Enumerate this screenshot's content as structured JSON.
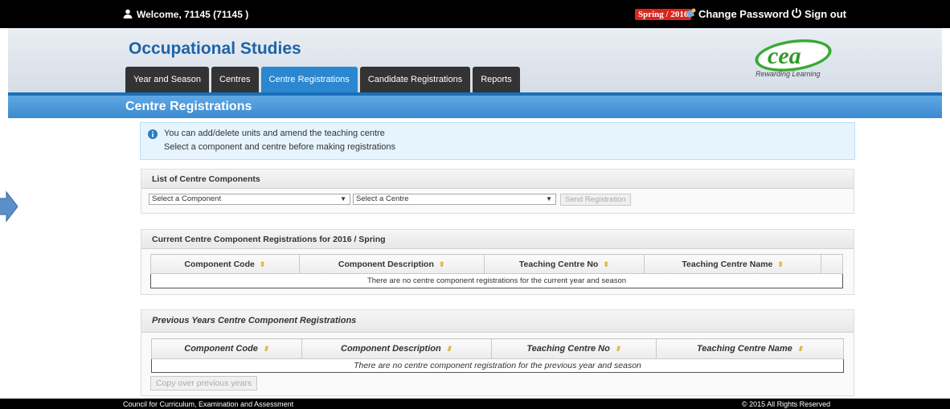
{
  "topbar": {
    "welcome": "Welcome, 71145 (71145 )",
    "season_badge": "Spring / 2016",
    "change_password": "Change Password",
    "sign_out": "Sign out"
  },
  "header": {
    "title": "Occupational Studies",
    "logo_text": "cea",
    "logo_tagline": "Rewarding Learning",
    "tabs": [
      {
        "label": "Year and Season"
      },
      {
        "label": "Centres"
      },
      {
        "label": "Centre Registrations",
        "active": true
      },
      {
        "label": "Candidate Registrations"
      },
      {
        "label": "Reports"
      }
    ]
  },
  "page": {
    "title": "Centre Registrations"
  },
  "info": {
    "line1": "You can add/delete units and amend the teaching centre",
    "line2": "Select a component and centre before making registrations"
  },
  "components_panel": {
    "title": "List of Centre Components",
    "component_select": "Select a Component",
    "centre_select": "Select a Centre",
    "send_button": "Send Registration"
  },
  "current_panel": {
    "title": "Current Centre Component Registrations for 2016 / Spring",
    "columns": [
      "Component Code",
      "Component Description",
      "Teaching Centre No",
      "Teaching Centre Name"
    ],
    "empty_message": "There are no centre component registrations for the current year and season"
  },
  "previous_panel": {
    "title": "Previous Years Centre Component Registrations",
    "columns": [
      "Component Code",
      "Component Description",
      "Teaching Centre No",
      "Teaching Centre Name"
    ],
    "empty_message": "There are no centre component registration for the previous year and season",
    "copy_button": "Copy over previous years"
  },
  "footer": {
    "left": "Council for Curriculum, Examination and Assessment",
    "right": "© 2015 All Rights Reserved"
  },
  "colors": {
    "accent": "#2a87d0",
    "title_blue": "#1f63a8",
    "badge_red": "#d9251d",
    "logo_green": "#3aaa35"
  }
}
